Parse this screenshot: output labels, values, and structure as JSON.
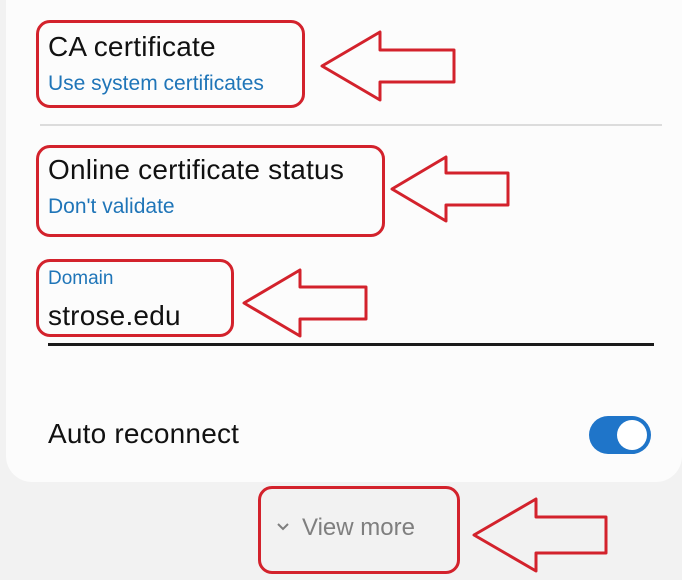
{
  "ca_certificate": {
    "title": "CA certificate",
    "value": "Use system certificates"
  },
  "online_certificate_status": {
    "title": "Online certificate status",
    "value": "Don't validate"
  },
  "domain": {
    "label": "Domain",
    "value": "strose.edu"
  },
  "auto_reconnect": {
    "label": "Auto reconnect",
    "enabled": true
  },
  "view_more": {
    "label": "View more",
    "icon": "chevron-down-icon"
  },
  "colors": {
    "accent_blue": "#1f75b8",
    "toggle_on": "#1f75c9",
    "annotation_red": "#d3222c",
    "background": "#f2f2f2",
    "card": "#fcfcfc"
  }
}
